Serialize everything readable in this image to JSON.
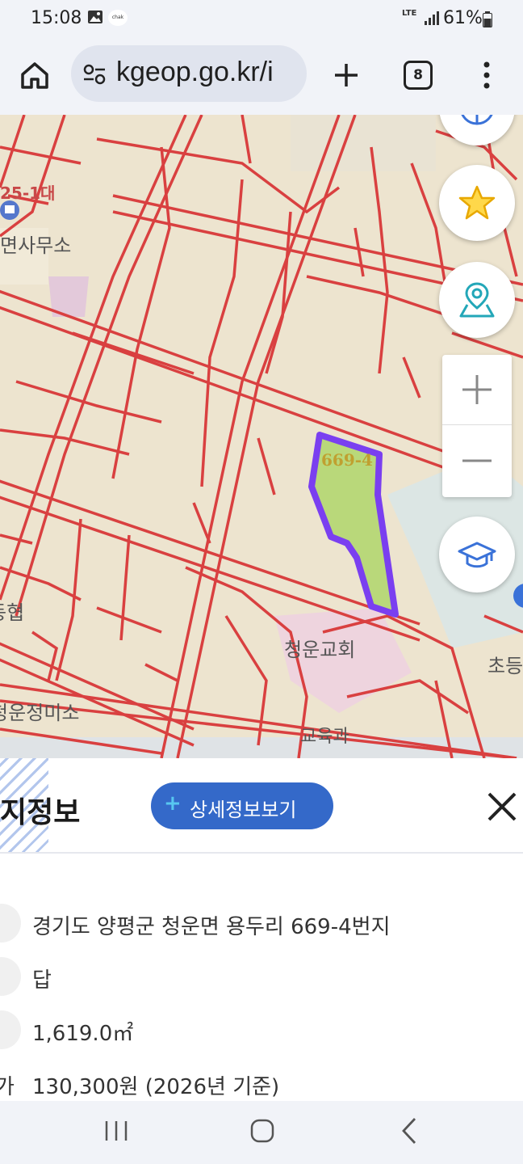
{
  "status_bar": {
    "time": "15:08",
    "network": "LTE",
    "battery": "61%",
    "chk_app": "chak"
  },
  "browser": {
    "url": "kgeop.go.kr/i",
    "tab_count": "8"
  },
  "map": {
    "labels": {
      "top_left_lot": "25-1대",
      "office": "면사무소",
      "parcel": "669-4",
      "left_mid": "동협",
      "church": "청운교회",
      "education": "교육과",
      "bottom_left": "청운정미소",
      "right_school": "초등"
    },
    "colors": {
      "parcel_lines": "#d94040",
      "selected_fill": "#b9d87a",
      "selected_outline": "#7a3ff0",
      "background": "#ede4cf"
    }
  },
  "panel": {
    "title": "지정보",
    "detail_button": "상세정보보기",
    "detail_button_plus": "+",
    "rows": [
      {
        "prefix": "",
        "value": "경기도 양평군 청운면 용두리 669-4번지"
      },
      {
        "prefix": "",
        "value": "답"
      },
      {
        "prefix": "",
        "value": "1,619.0㎡"
      },
      {
        "prefix": "가",
        "value": "130,300원 (2026년 기준)"
      }
    ]
  }
}
